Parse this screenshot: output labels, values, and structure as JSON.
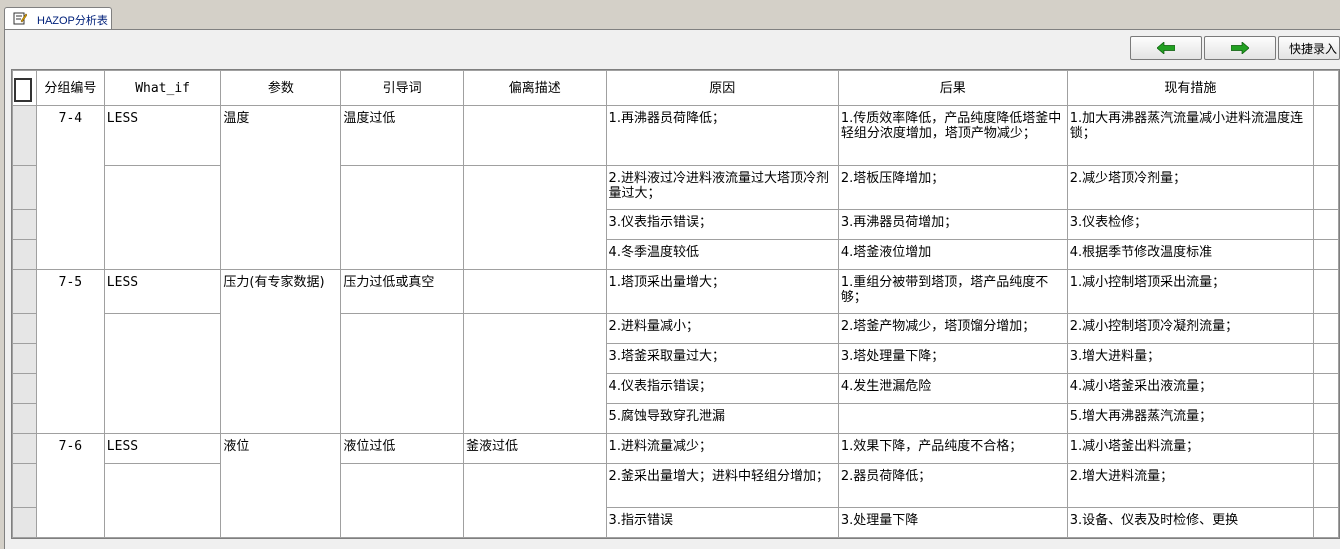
{
  "tab": {
    "label": "HAZOP分析表"
  },
  "toolbar": {
    "prev_icon": "green-left-arrow",
    "next_icon": "green-right-arrow",
    "quick_entry_label": "快捷录入"
  },
  "colors": {
    "arrow": "#22a022",
    "background": "#d4d0c8",
    "tab_text": "#00207a"
  },
  "table": {
    "headers": [
      "分组编号",
      "What_if",
      "参数",
      "引导词",
      "偏离描述",
      "原因",
      "后果",
      "现有措施"
    ],
    "groups": [
      {
        "id": "7-4",
        "what_if": "LESS",
        "param": "温度",
        "guide": "温度过低",
        "deviation": "",
        "rows": [
          {
            "cause": "1.再沸器员荷降低；",
            "consequence": "1.传质效率降低，产品纯度降低塔釜中轻组分浓度增加，塔顶产物减少；",
            "measure": "1.加大再沸器蒸汽流量减小进料流温度连锁；"
          },
          {
            "cause": "2.进料液过冷进料液流量过大塔顶冷剂量过大；",
            "consequence": "2.塔板压降增加；",
            "measure": "2.减少塔顶冷剂量；"
          },
          {
            "cause": "3.仪表指示错误；",
            "consequence": "3.再沸器员荷增加；",
            "measure": "3.仪表检修；"
          },
          {
            "cause": "4.冬季温度较低",
            "consequence": "4.塔釜液位增加",
            "measure": "4.根据季节修改温度标准"
          }
        ]
      },
      {
        "id": "7-5",
        "what_if": "LESS",
        "param": "压力(有专家数据)",
        "guide": "压力过低或真空",
        "deviation": "",
        "rows": [
          {
            "cause": "1.塔顶采出量增大；",
            "consequence": "1.重组分被带到塔顶，塔产品纯度不够；",
            "measure": "1.减小控制塔顶采出流量；"
          },
          {
            "cause": "2.进料量减小；",
            "consequence": "2.塔釜产物减少，塔顶馏分增加；",
            "measure": "2.减小控制塔顶冷凝剂流量；"
          },
          {
            "cause": "3.塔釜采取量过大；",
            "consequence": "3.塔处理量下降；",
            "measure": "3.增大进料量；"
          },
          {
            "cause": "4.仪表指示错误；",
            "consequence": "4.发生泄漏危险",
            "measure": "4.减小塔釜采出液流量；"
          },
          {
            "cause": "5.腐蚀导致穿孔泄漏",
            "consequence": "",
            "measure": "5.增大再沸器蒸汽流量；"
          }
        ]
      },
      {
        "id": "7-6",
        "what_if": "LESS",
        "param": "液位",
        "guide": "液位过低",
        "deviation": "釜液过低",
        "rows": [
          {
            "cause": "1.进料流量减少；",
            "consequence": "1.效果下降，产品纯度不合格；",
            "measure": "1.减小塔釜出料流量；"
          },
          {
            "cause": "2.釜采出量增大；进料中轻组分增加；",
            "consequence": "2.器员荷降低；",
            "measure": "2.增大进料流量；"
          },
          {
            "cause": "3.指示错误",
            "consequence": "3.处理量下降",
            "measure": "3.设备、仪表及时检修、更换"
          }
        ]
      }
    ]
  }
}
